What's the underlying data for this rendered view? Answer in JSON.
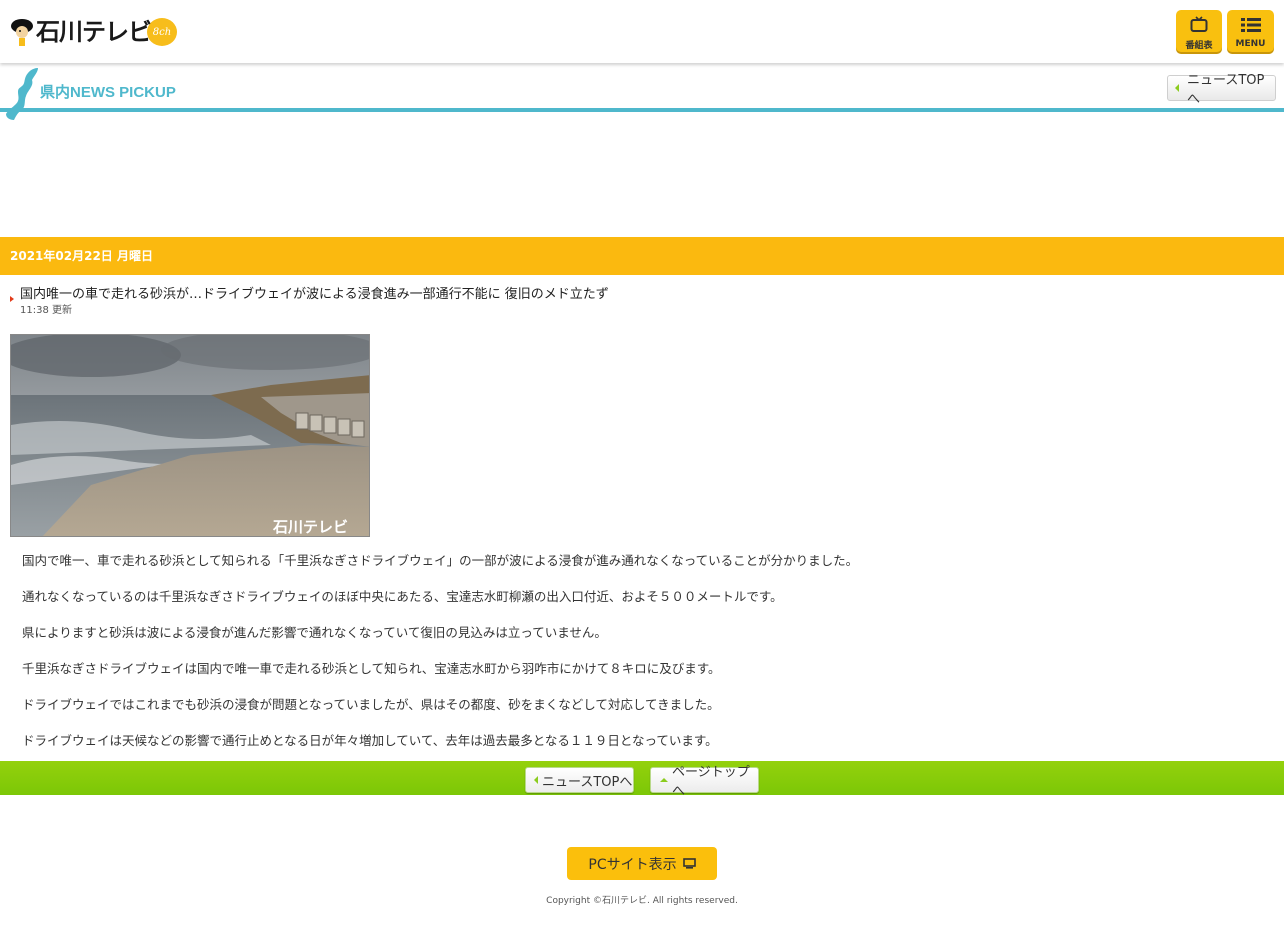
{
  "header": {
    "logo_text": "石川テレビ",
    "channel_badge": "8ch",
    "program_button_label": "番組表",
    "program_icon": "tv-icon",
    "menu_button_label": "MENU",
    "menu_icon": "list-icon"
  },
  "section": {
    "title": "県内NEWS PICKUP",
    "news_top_label": "ニュースTOPへ",
    "accent_color": "#4fb8cc"
  },
  "date_bar": {
    "label": "2021年02月22日 月曜日",
    "color": "#fbb90f"
  },
  "article": {
    "title": "国内唯一の車で走れる砂浜が…ドライブウェイが波による浸食進み一部通行不能に 復旧のメド立たず",
    "time": "11:38 更新",
    "photo_watermark": "石川テレビ",
    "paragraphs": [
      "国内で唯一、車で走れる砂浜として知られる「千里浜なぎさドライブウェイ」の一部が波による浸食が進み通れなくなっていることが分かりました。",
      "通れなくなっているのは千里浜なぎさドライブウェイのほぼ中央にあたる、宝達志水町柳瀬の出入口付近、およそ５００メートルです。",
      "県によりますと砂浜は波による浸食が進んだ影響で通れなくなっていて復旧の見込みは立っていません。",
      "千里浜なぎさドライブウェイは国内で唯一車で走れる砂浜として知られ、宝達志水町から羽咋市にかけて８キロに及びます。",
      "ドライブウェイではこれまでも砂浜の浸食が問題となっていましたが、県はその都度、砂をまくなどして対応してきました。",
      "ドライブウェイは天候などの影響で通行止めとなる日が年々増加していて、去年は過去最多となる１１９日となっています。"
    ]
  },
  "footer_nav": {
    "news_top_label": "ニュースTOPへ",
    "page_top_label": "ページトップへ",
    "color": "#7cc707"
  },
  "footer": {
    "pc_site_label": "PCサイト表示",
    "pc_icon": "monitor-icon",
    "copyright": "Copyright ©石川テレビ. All rights reserved."
  }
}
